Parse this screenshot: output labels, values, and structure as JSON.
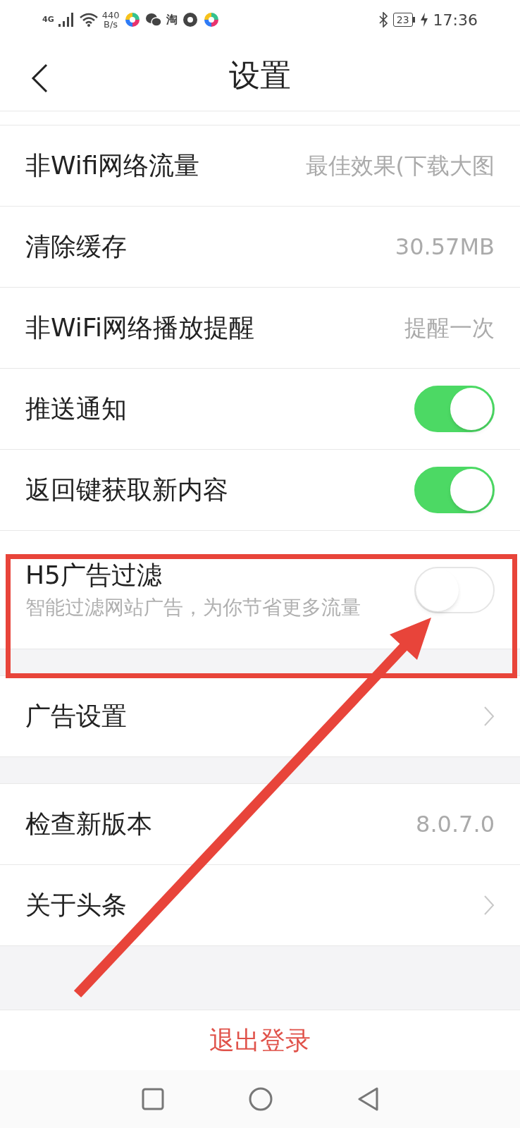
{
  "status_bar": {
    "network": "4G",
    "speed": "440",
    "speed_unit": "B/s",
    "taobao": "淘",
    "battery": "23",
    "time": "17:36"
  },
  "header": {
    "title": "设置"
  },
  "groups": [
    {
      "items": [
        {
          "kind": "value",
          "label": "非Wifi网络流量",
          "value": "最佳效果(下载大图"
        },
        {
          "kind": "value",
          "label": "清除缓存",
          "value": "30.57MB"
        },
        {
          "kind": "value",
          "label": "非WiFi网络播放提醒",
          "value": "提醒一次"
        },
        {
          "kind": "toggle",
          "label": "推送通知",
          "on": true
        },
        {
          "kind": "toggle",
          "label": "返回键获取新内容",
          "on": true
        },
        {
          "kind": "toggle",
          "label": "H5广告过滤",
          "description": "智能过滤网站广告，为你节省更多流量",
          "on": false
        }
      ]
    },
    {
      "items": [
        {
          "kind": "link",
          "label": "广告设置"
        }
      ]
    },
    {
      "items": [
        {
          "kind": "value",
          "label": "检查新版本",
          "value": "8.0.7.0"
        },
        {
          "kind": "link",
          "label": "关于头条"
        }
      ]
    }
  ],
  "logout": "退出登录"
}
